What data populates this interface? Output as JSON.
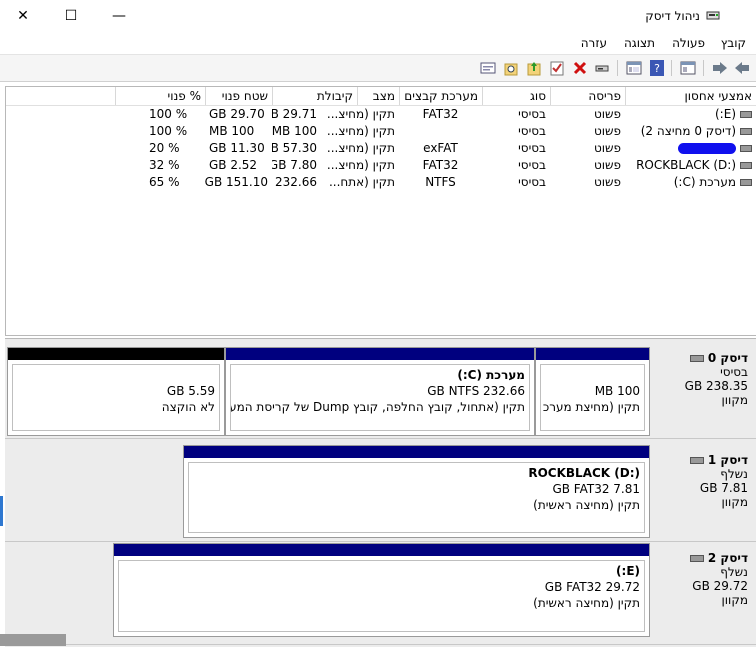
{
  "window": {
    "title": "ניהול דיסק",
    "close_icon": "✕",
    "maximize_icon": "☐",
    "minimize_icon": "—"
  },
  "menu": [
    "קובץ",
    "פעולה",
    "תצוגה",
    "עזרה"
  ],
  "toolbar": {
    "icons": [
      "back-icon",
      "forward-icon",
      "properties-icon",
      "help-icon",
      "console-icon",
      "refresh-icon",
      "delete-icon",
      "checkbox-icon",
      "up-folder-icon",
      "search-folder-icon",
      "export-icon"
    ]
  },
  "volume_table": {
    "headers": [
      "אמצעי אחסון",
      "פריסה",
      "סוג",
      "מערכת קבצים",
      "מצב",
      "קיבולת",
      "שטח פנוי",
      "% פנוי"
    ],
    "rows": [
      {
        "volume": "(E:)",
        "layout": "פשוט",
        "type": "בסיסי",
        "fs": "FAT32",
        "status": "תקין (מחיצ...",
        "capacity": "GB 29.71",
        "free": "GB 29.70",
        "pct": "% 100",
        "redacted": false
      },
      {
        "volume": "(דיסק 0 מחיצה 2)",
        "layout": "פשוט",
        "type": "בסיסי",
        "fs": "",
        "status": "תקין (מחיצ...",
        "capacity": "MB 100",
        "free": "MB 100",
        "pct": "% 100",
        "redacted": false
      },
      {
        "volume": "",
        "layout": "פשוט",
        "type": "בסיסי",
        "fs": "exFAT",
        "status": "תקין (מחיצ...",
        "capacity": "GB 57.30",
        "free": "GB 11.30",
        "pct": "% 20",
        "redacted": true
      },
      {
        "volume": "ROCKBLACK (D:)",
        "layout": "פשוט",
        "type": "בסיסי",
        "fs": "FAT32",
        "status": "תקין (מחיצ...",
        "capacity": "GB 7.80",
        "free": "GB 2.52",
        "pct": "% 32",
        "redacted": false
      },
      {
        "volume": "מערכת (C:)",
        "layout": "פשוט",
        "type": "בסיסי",
        "fs": "NTFS",
        "status": "תקין (אתח...",
        "capacity": "GB 232.66",
        "free": "GB 151.10",
        "pct": "% 65",
        "redacted": false
      }
    ]
  },
  "disks": [
    {
      "name": "דיסק 0",
      "kind": "בסיסי",
      "size": "GB 238.35",
      "state": "מקוון",
      "partitions": [
        {
          "title": "",
          "line1": "MB 100",
          "line2": "תקין (מחיצת מערכ"
        },
        {
          "title": "מערכת  (C:)",
          "line1": "GB NTFS 232.66",
          "line2": "תקין (אתחול, קובץ החלפה, קובץ Dump של קריסת המער"
        },
        {
          "title": "",
          "line1": "GB 5.59",
          "line2": "לא הוקצה"
        }
      ]
    },
    {
      "name": "דיסק 1",
      "kind": "נשלף",
      "size": "GB 7.81",
      "state": "מקוון",
      "partitions": [
        {
          "title": "ROCKBLACK  (D:)",
          "line1": "GB FAT32 7.81",
          "line2": "תקין (מחיצה ראשית)"
        }
      ]
    },
    {
      "name": "דיסק 2",
      "kind": "נשלף",
      "size": "GB 29.72",
      "state": "מקוון",
      "partitions": [
        {
          "title": "(E:)",
          "line1": "GB FAT32 29.72",
          "line2": "תקין (מחיצה ראשית)"
        }
      ]
    }
  ],
  "colors": {
    "primary_bar": "#00007f",
    "unallocated_bar": "#000000",
    "redaction": "#1010ee"
  }
}
